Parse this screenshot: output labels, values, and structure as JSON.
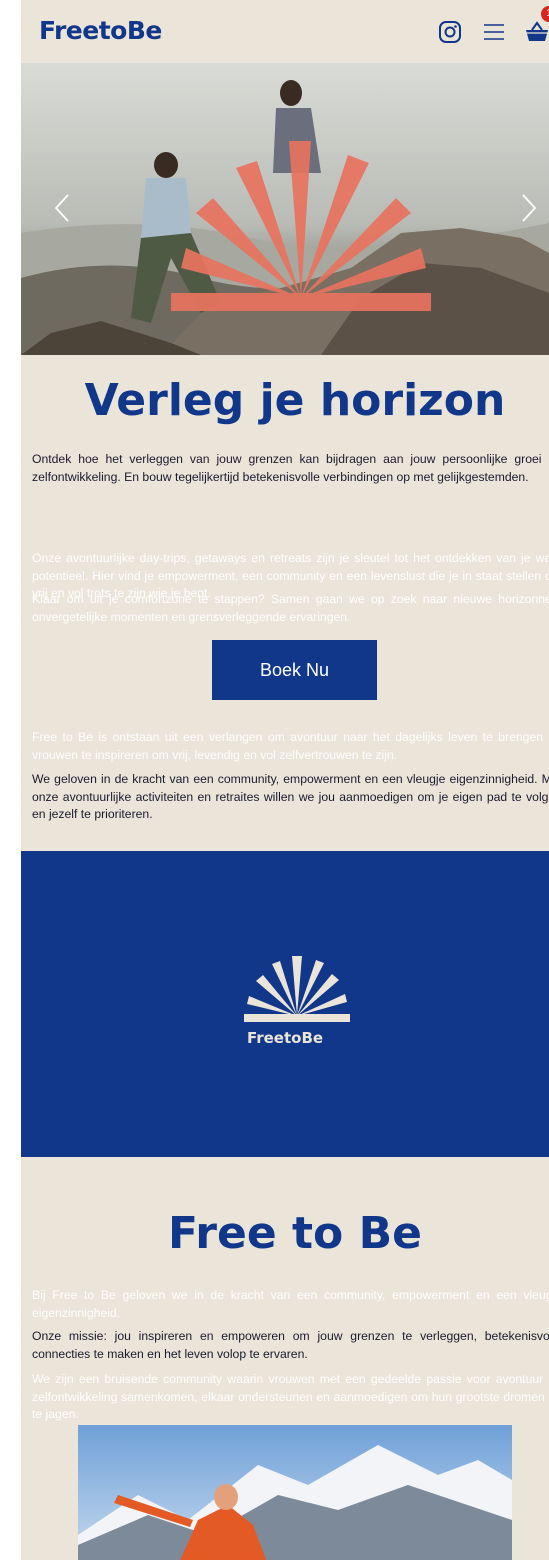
{
  "header": {
    "logo": "FreetoBe",
    "cart_count": "1",
    "icons": [
      "instagram-icon",
      "menu-icon",
      "cart-icon"
    ]
  },
  "hero": {
    "image": "two hikers helping each other climb a rock with sun logo overlay",
    "prev_icon": "chevron-left-icon",
    "next_icon": "chevron-right-icon"
  },
  "intro": {
    "title": "Verleg je horizon",
    "p1": "Ontdek hoe het verleggen van jouw grenzen kan bijdragen aan jouw persoonlijke groei en zelfontwikkeling. En bouw tegelijkertijd betekenisvolle verbindingen op met gelijkgestemden.",
    "p2": "Onze avontuurlijke day-trips, getaways en retreats zijn je sleutel tot het ontdekken van je ware potentieel. Hier vind je empowerment, een community en een levenslust die je in staat stellen om vrij en vol trots te zijn wie je bent.",
    "p3": "Klaar om uit je comfortzone te stappen? Samen gaan we op zoek naar nieuwe horizonnen, onvergetelijke momenten en grensverleggende ervaringen.",
    "button": "Boek Nu",
    "p4": "Free to Be is ontstaan uit een verlangen om avontuur naar het dagelijks leven te brengen en vrouwen te inspireren om vrij, levendig en vol zelfvertrouwen te zijn.",
    "p5": "We geloven in de kracht van een community, empowerment en een vleugje eigenzinnigheid. Met onze avontuurlijke activiteiten en retraites willen we jou aanmoedigen om je eigen pad te volgen en jezelf te prioriteren."
  },
  "band": {
    "logo_word": "FreetoBe",
    "colors": {
      "navy": "#10378a",
      "cream": "#ebe4d8",
      "coral": "#e8735f"
    }
  },
  "about": {
    "title": "Free to Be",
    "p1": "Bij Free to Be geloven we in de kracht van een community, empowerment en een vleugje eigenzinnigheid.",
    "p2": "Onze missie: jou inspireren en empoweren om jouw grenzen te verleggen, betekenisvolle connecties te maken en het leven volop te ervaren.",
    "p3": "We zijn een bruisende community waarin vrouwen met een gedeelde passie voor avontuur en zelfontwikkeling samenkomen, elkaar ondersteunen en aanmoedigen om hun grootste dromen na te jagen."
  }
}
